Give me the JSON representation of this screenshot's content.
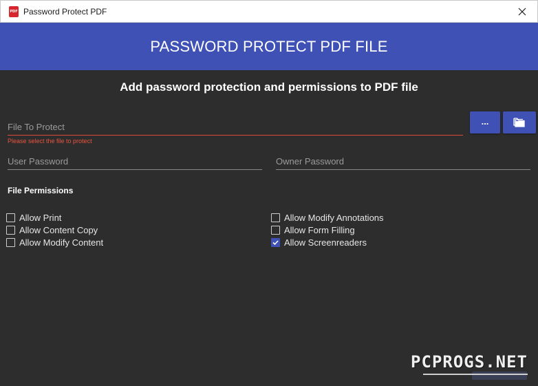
{
  "window": {
    "title": "Password Protect PDF",
    "icon_text": "PDF"
  },
  "banner": {
    "title": "PASSWORD PROTECT PDF FILE"
  },
  "subheading": "Add password protection and permissions to PDF file",
  "file_field": {
    "placeholder": "File To Protect",
    "value": "",
    "error": "Please select the file to protect"
  },
  "browse_button": {
    "label": "..."
  },
  "folder_button": {
    "icon": "folder-icon"
  },
  "user_password": {
    "placeholder": "User Password",
    "value": ""
  },
  "owner_password": {
    "placeholder": "Owner Password",
    "value": ""
  },
  "permissions": {
    "heading": "File Permissions",
    "left": [
      {
        "label": "Allow Print",
        "checked": false
      },
      {
        "label": "Allow Content Copy",
        "checked": false
      },
      {
        "label": "Allow Modify Content",
        "checked": false
      }
    ],
    "right": [
      {
        "label": "Allow Modify Annotations",
        "checked": false
      },
      {
        "label": "Allow Form Filling",
        "checked": false
      },
      {
        "label": "Allow Screenreaders",
        "checked": true
      }
    ]
  },
  "watermark": "PCPROGS.NET",
  "colors": {
    "accent": "#3f51b5",
    "background": "#2d2d2d",
    "error": "#e8543f"
  }
}
